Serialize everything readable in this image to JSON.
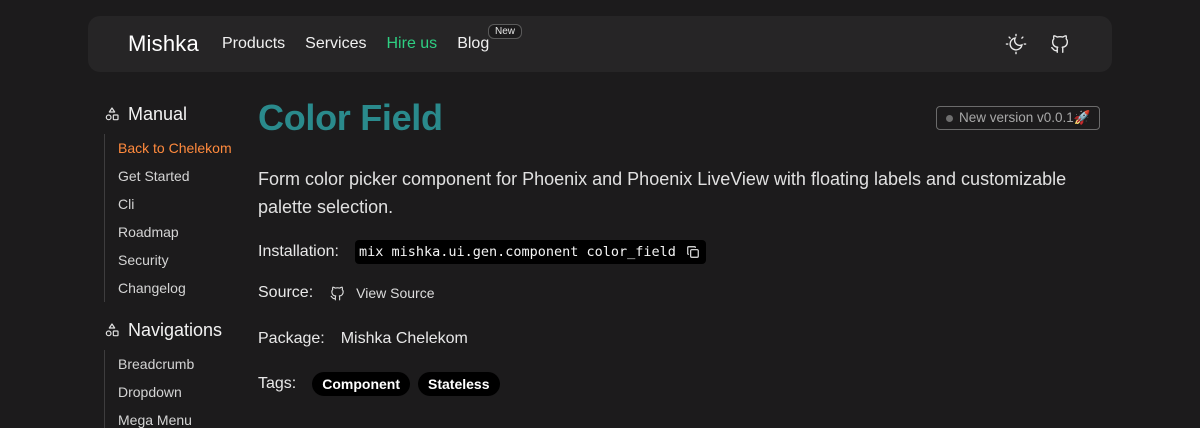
{
  "header": {
    "brand": "Mishka",
    "nav": [
      {
        "label": "Products"
      },
      {
        "label": "Services"
      },
      {
        "label": "Hire us"
      },
      {
        "label": "Blog"
      }
    ],
    "blog_badge": "New",
    "icons": [
      "theme-toggle-icon",
      "github-icon"
    ]
  },
  "sidebar": {
    "sections": [
      {
        "title": "Manual",
        "icon": "shapes-icon",
        "items": [
          "Back to Chelekom",
          "Get Started",
          "Cli",
          "Roadmap",
          "Security",
          "Changelog"
        ]
      },
      {
        "title": "Navigations",
        "icon": "shapes-icon",
        "items": [
          "Breadcrumb",
          "Dropdown",
          "Mega Menu"
        ]
      }
    ]
  },
  "main": {
    "title": "Color Field",
    "version": "New version v0.0.1🚀",
    "description": "Form color picker component for Phoenix and Phoenix LiveView with floating labels and customizable palette selection.",
    "installation": {
      "label": "Installation:",
      "command": "mix mishka.ui.gen.component color_field"
    },
    "source": {
      "label": "Source:",
      "link": "View Source"
    },
    "package": {
      "label": "Package:",
      "value": "Mishka Chelekom"
    },
    "tags": {
      "label": "Tags:",
      "items": [
        "Component",
        "Stateless"
      ]
    }
  },
  "colors": {
    "background": "#1c1b1c",
    "header_bg": "#262526",
    "title": "#2a8a8c",
    "active_link": "#ff8a3d",
    "hire_us": "#2ecf82"
  }
}
